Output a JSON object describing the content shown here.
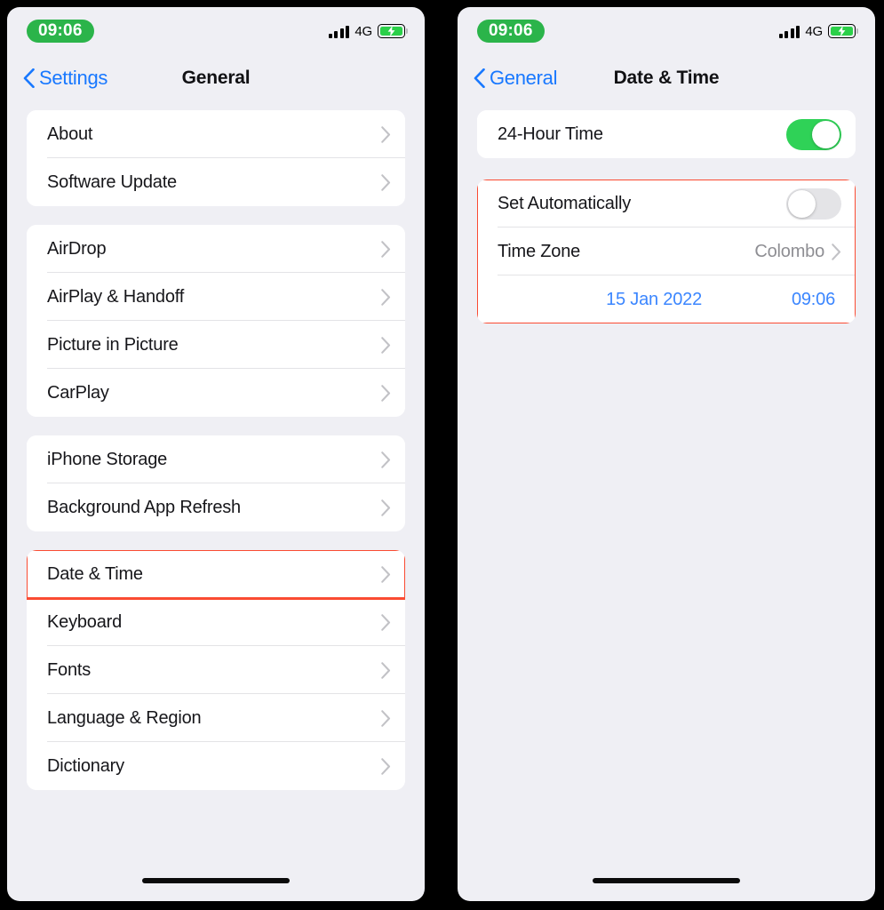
{
  "status_bar": {
    "time": "09:06",
    "network": "4G",
    "signal_bars": 4,
    "battery_charging": true,
    "time_pill_color": "#2BB44A",
    "battery_color": "#2BD049"
  },
  "colors": {
    "accent_blue": "#1878FF",
    "value_blue": "#3B86FF",
    "toggle_on_green": "#2FD257",
    "toggle_off_gray": "#E4E4E7",
    "highlight_red": "#FA4B32",
    "page_background": "#EFEFF4",
    "card_background": "#FFFFFF",
    "secondary_text": "#8E8E93"
  },
  "screens": [
    {
      "id": "general",
      "nav": {
        "back_label": "Settings",
        "title": "General",
        "back_icon": "chevron-left-icon"
      },
      "groups": [
        {
          "id": "about-group",
          "highlighted": false,
          "rows": [
            {
              "label": "About",
              "type": "link",
              "accessory": "chevron-right-icon"
            },
            {
              "label": "Software Update",
              "type": "link",
              "accessory": "chevron-right-icon"
            }
          ]
        },
        {
          "id": "connectivity-group",
          "highlighted": false,
          "rows": [
            {
              "label": "AirDrop",
              "type": "link",
              "accessory": "chevron-right-icon"
            },
            {
              "label": "AirPlay & Handoff",
              "type": "link",
              "accessory": "chevron-right-icon"
            },
            {
              "label": "Picture in Picture",
              "type": "link",
              "accessory": "chevron-right-icon"
            },
            {
              "label": "CarPlay",
              "type": "link",
              "accessory": "chevron-right-icon"
            }
          ]
        },
        {
          "id": "storage-group",
          "highlighted": false,
          "rows": [
            {
              "label": "iPhone Storage",
              "type": "link",
              "accessory": "chevron-right-icon"
            },
            {
              "label": "Background App Refresh",
              "type": "link",
              "accessory": "chevron-right-icon"
            }
          ]
        },
        {
          "id": "localization-group",
          "highlighted": false,
          "rows": [
            {
              "label": "Date & Time",
              "type": "link",
              "accessory": "chevron-right-icon",
              "highlighted": true
            },
            {
              "label": "Keyboard",
              "type": "link",
              "accessory": "chevron-right-icon"
            },
            {
              "label": "Fonts",
              "type": "link",
              "accessory": "chevron-right-icon"
            },
            {
              "label": "Language & Region",
              "type": "link",
              "accessory": "chevron-right-icon"
            },
            {
              "label": "Dictionary",
              "type": "link",
              "accessory": "chevron-right-icon"
            }
          ]
        }
      ]
    },
    {
      "id": "date-time",
      "nav": {
        "back_label": "General",
        "title": "Date & Time",
        "back_icon": "chevron-left-icon"
      },
      "groups": [
        {
          "id": "hour-format-group",
          "highlighted": false,
          "rows": [
            {
              "label": "24-Hour Time",
              "type": "toggle",
              "toggle_state": "on"
            }
          ]
        },
        {
          "id": "automatic-group",
          "highlighted": true,
          "rows": [
            {
              "label": "Set Automatically",
              "type": "toggle",
              "toggle_state": "off"
            },
            {
              "label": "Time Zone",
              "type": "link",
              "value": "Colombo",
              "accessory": "chevron-right-icon"
            },
            {
              "label": "",
              "type": "datetime",
              "date_value": "15 Jan 2022",
              "time_value": "09:06"
            }
          ]
        }
      ]
    }
  ]
}
